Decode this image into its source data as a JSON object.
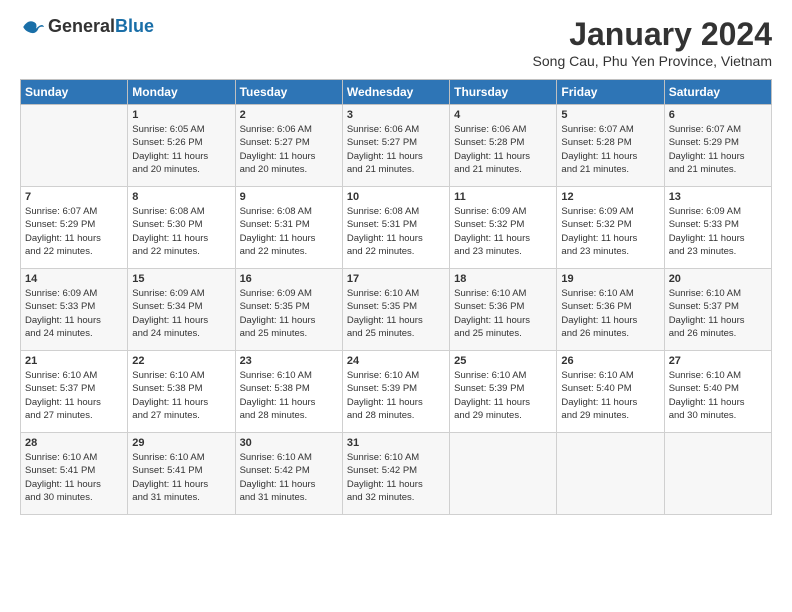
{
  "header": {
    "logo_general": "General",
    "logo_blue": "Blue",
    "month_title": "January 2024",
    "subtitle": "Song Cau, Phu Yen Province, Vietnam"
  },
  "days_of_week": [
    "Sunday",
    "Monday",
    "Tuesday",
    "Wednesday",
    "Thursday",
    "Friday",
    "Saturday"
  ],
  "weeks": [
    [
      {
        "day": "",
        "info": ""
      },
      {
        "day": "1",
        "info": "Sunrise: 6:05 AM\nSunset: 5:26 PM\nDaylight: 11 hours\nand 20 minutes."
      },
      {
        "day": "2",
        "info": "Sunrise: 6:06 AM\nSunset: 5:27 PM\nDaylight: 11 hours\nand 20 minutes."
      },
      {
        "day": "3",
        "info": "Sunrise: 6:06 AM\nSunset: 5:27 PM\nDaylight: 11 hours\nand 21 minutes."
      },
      {
        "day": "4",
        "info": "Sunrise: 6:06 AM\nSunset: 5:28 PM\nDaylight: 11 hours\nand 21 minutes."
      },
      {
        "day": "5",
        "info": "Sunrise: 6:07 AM\nSunset: 5:28 PM\nDaylight: 11 hours\nand 21 minutes."
      },
      {
        "day": "6",
        "info": "Sunrise: 6:07 AM\nSunset: 5:29 PM\nDaylight: 11 hours\nand 21 minutes."
      }
    ],
    [
      {
        "day": "7",
        "info": "Sunrise: 6:07 AM\nSunset: 5:29 PM\nDaylight: 11 hours\nand 22 minutes."
      },
      {
        "day": "8",
        "info": "Sunrise: 6:08 AM\nSunset: 5:30 PM\nDaylight: 11 hours\nand 22 minutes."
      },
      {
        "day": "9",
        "info": "Sunrise: 6:08 AM\nSunset: 5:31 PM\nDaylight: 11 hours\nand 22 minutes."
      },
      {
        "day": "10",
        "info": "Sunrise: 6:08 AM\nSunset: 5:31 PM\nDaylight: 11 hours\nand 22 minutes."
      },
      {
        "day": "11",
        "info": "Sunrise: 6:09 AM\nSunset: 5:32 PM\nDaylight: 11 hours\nand 23 minutes."
      },
      {
        "day": "12",
        "info": "Sunrise: 6:09 AM\nSunset: 5:32 PM\nDaylight: 11 hours\nand 23 minutes."
      },
      {
        "day": "13",
        "info": "Sunrise: 6:09 AM\nSunset: 5:33 PM\nDaylight: 11 hours\nand 23 minutes."
      }
    ],
    [
      {
        "day": "14",
        "info": "Sunrise: 6:09 AM\nSunset: 5:33 PM\nDaylight: 11 hours\nand 24 minutes."
      },
      {
        "day": "15",
        "info": "Sunrise: 6:09 AM\nSunset: 5:34 PM\nDaylight: 11 hours\nand 24 minutes."
      },
      {
        "day": "16",
        "info": "Sunrise: 6:09 AM\nSunset: 5:35 PM\nDaylight: 11 hours\nand 25 minutes."
      },
      {
        "day": "17",
        "info": "Sunrise: 6:10 AM\nSunset: 5:35 PM\nDaylight: 11 hours\nand 25 minutes."
      },
      {
        "day": "18",
        "info": "Sunrise: 6:10 AM\nSunset: 5:36 PM\nDaylight: 11 hours\nand 25 minutes."
      },
      {
        "day": "19",
        "info": "Sunrise: 6:10 AM\nSunset: 5:36 PM\nDaylight: 11 hours\nand 26 minutes."
      },
      {
        "day": "20",
        "info": "Sunrise: 6:10 AM\nSunset: 5:37 PM\nDaylight: 11 hours\nand 26 minutes."
      }
    ],
    [
      {
        "day": "21",
        "info": "Sunrise: 6:10 AM\nSunset: 5:37 PM\nDaylight: 11 hours\nand 27 minutes."
      },
      {
        "day": "22",
        "info": "Sunrise: 6:10 AM\nSunset: 5:38 PM\nDaylight: 11 hours\nand 27 minutes."
      },
      {
        "day": "23",
        "info": "Sunrise: 6:10 AM\nSunset: 5:38 PM\nDaylight: 11 hours\nand 28 minutes."
      },
      {
        "day": "24",
        "info": "Sunrise: 6:10 AM\nSunset: 5:39 PM\nDaylight: 11 hours\nand 28 minutes."
      },
      {
        "day": "25",
        "info": "Sunrise: 6:10 AM\nSunset: 5:39 PM\nDaylight: 11 hours\nand 29 minutes."
      },
      {
        "day": "26",
        "info": "Sunrise: 6:10 AM\nSunset: 5:40 PM\nDaylight: 11 hours\nand 29 minutes."
      },
      {
        "day": "27",
        "info": "Sunrise: 6:10 AM\nSunset: 5:40 PM\nDaylight: 11 hours\nand 30 minutes."
      }
    ],
    [
      {
        "day": "28",
        "info": "Sunrise: 6:10 AM\nSunset: 5:41 PM\nDaylight: 11 hours\nand 30 minutes."
      },
      {
        "day": "29",
        "info": "Sunrise: 6:10 AM\nSunset: 5:41 PM\nDaylight: 11 hours\nand 31 minutes."
      },
      {
        "day": "30",
        "info": "Sunrise: 6:10 AM\nSunset: 5:42 PM\nDaylight: 11 hours\nand 31 minutes."
      },
      {
        "day": "31",
        "info": "Sunrise: 6:10 AM\nSunset: 5:42 PM\nDaylight: 11 hours\nand 32 minutes."
      },
      {
        "day": "",
        "info": ""
      },
      {
        "day": "",
        "info": ""
      },
      {
        "day": "",
        "info": ""
      }
    ]
  ]
}
